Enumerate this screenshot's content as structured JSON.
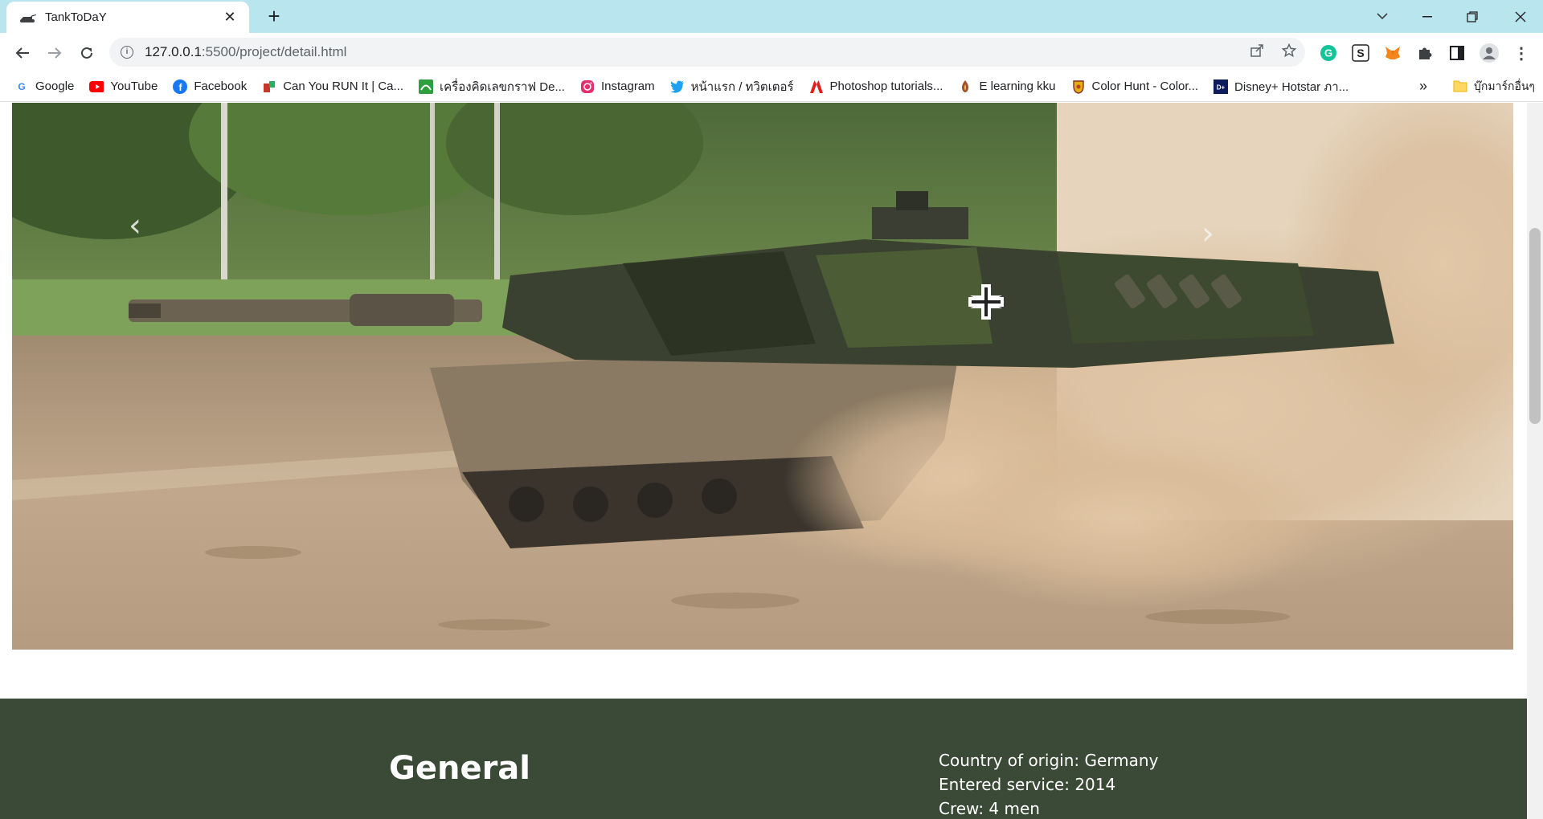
{
  "browser": {
    "tab_title": "TankToDaY",
    "url": "127.0.0.1:5500/project/detail.html",
    "url_host": "127.0.0.1",
    "url_path": ":5500/project/detail.html"
  },
  "bookmarks": [
    {
      "label": "Google",
      "icon": "google-icon",
      "color": "#4285f4"
    },
    {
      "label": "YouTube",
      "icon": "youtube-icon",
      "color": "#ff0000"
    },
    {
      "label": "Facebook",
      "icon": "facebook-icon",
      "color": "#1877f2"
    },
    {
      "label": "Can You RUN It | Ca...",
      "icon": "canyourunit-icon",
      "color": "#c0392b"
    },
    {
      "label": "เครื่องคิดเลขกราฟ De...",
      "icon": "desmos-icon",
      "color": "#2e9e3e"
    },
    {
      "label": "Instagram",
      "icon": "instagram-icon",
      "color": "#e1306c"
    },
    {
      "label": "หน้าแรก / ทวิตเตอร์",
      "icon": "twitter-icon",
      "color": "#1da1f2"
    },
    {
      "label": "Photoshop tutorials...",
      "icon": "adobe-icon",
      "color": "#e01e1e"
    },
    {
      "label": "E learning kku",
      "icon": "kku-icon",
      "color": "#a0522d"
    },
    {
      "label": "Color Hunt - Color...",
      "icon": "colorhunt-icon",
      "color": "#e2b007"
    },
    {
      "label": "Disney+ Hotstar ภา...",
      "icon": "hotstar-icon",
      "color": "#0c1c5c"
    }
  ],
  "bookmarks_more": "»",
  "bookmarks_other": "บุ๊กมาร์กอื่นๆ",
  "page": {
    "section_heading": "General",
    "specs": [
      "Country of origin: Germany",
      "Entered service: 2014",
      "Crew: 4 men"
    ],
    "carousel_prev": "‹",
    "carousel_next": "›"
  },
  "colors": {
    "tabstrip": "#b9e5ee",
    "info_section": "#3a4a36"
  }
}
